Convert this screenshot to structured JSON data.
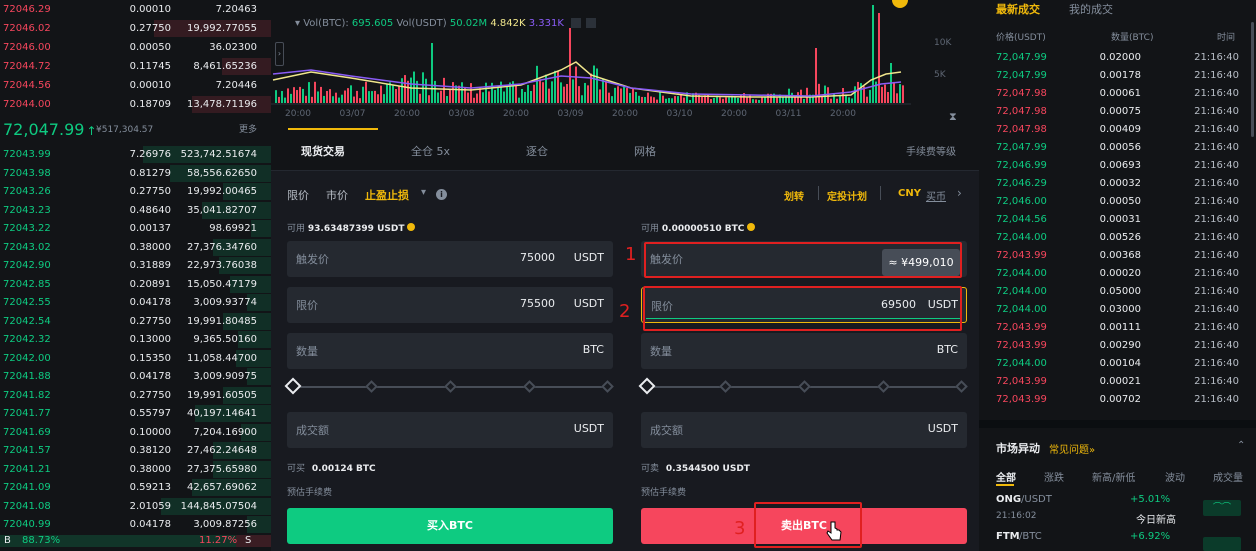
{
  "orderbook": {
    "asks": [
      {
        "price": "72046.29",
        "qty": "0.00010",
        "total": "7.20463"
      },
      {
        "price": "72046.02",
        "qty": "0.27750",
        "total": "19,992.77055"
      },
      {
        "price": "72046.00",
        "qty": "0.00050",
        "total": "36.02300"
      },
      {
        "price": "72044.72",
        "qty": "0.11745",
        "total": "8,461.65236"
      },
      {
        "price": "72044.56",
        "qty": "0.00010",
        "total": "7.20446"
      },
      {
        "price": "72044.00",
        "qty": "0.18709",
        "total": "13,478.71196"
      }
    ],
    "mid_price": "72,047.99",
    "mid_arrow": "↑",
    "mid_cny": "¥517,304.57",
    "more_label": "更多",
    "bids": [
      {
        "price": "72043.99",
        "qty": "7.26976",
        "total": "523,742.51674"
      },
      {
        "price": "72043.98",
        "qty": "0.81279",
        "total": "58,556.62650"
      },
      {
        "price": "72043.26",
        "qty": "0.27750",
        "total": "19,992.00465"
      },
      {
        "price": "72043.23",
        "qty": "0.48640",
        "total": "35,041.82707"
      },
      {
        "price": "72043.22",
        "qty": "0.00137",
        "total": "98.69921"
      },
      {
        "price": "72043.02",
        "qty": "0.38000",
        "total": "27,376.34760"
      },
      {
        "price": "72042.90",
        "qty": "0.31889",
        "total": "22,973.76038"
      },
      {
        "price": "72042.85",
        "qty": "0.20891",
        "total": "15,050.47179"
      },
      {
        "price": "72042.55",
        "qty": "0.04178",
        "total": "3,009.93774"
      },
      {
        "price": "72042.54",
        "qty": "0.27750",
        "total": "19,991.80485"
      },
      {
        "price": "72042.32",
        "qty": "0.13000",
        "total": "9,365.50160"
      },
      {
        "price": "72042.00",
        "qty": "0.15350",
        "total": "11,058.44700"
      },
      {
        "price": "72041.88",
        "qty": "0.04178",
        "total": "3,009.90975"
      },
      {
        "price": "72041.82",
        "qty": "0.27750",
        "total": "19,991.60505"
      },
      {
        "price": "72041.77",
        "qty": "0.55797",
        "total": "40,197.14641"
      },
      {
        "price": "72041.69",
        "qty": "0.10000",
        "total": "7,204.16900"
      },
      {
        "price": "72041.57",
        "qty": "0.38120",
        "total": "27,462.24648"
      },
      {
        "price": "72041.21",
        "qty": "0.38000",
        "total": "27,375.65980"
      },
      {
        "price": "72041.09",
        "qty": "0.59213",
        "total": "42,657.69062"
      },
      {
        "price": "72041.08",
        "qty": "2.01059",
        "total": "144,845.07504"
      },
      {
        "price": "72040.99",
        "qty": "0.04178",
        "total": "3,009.87256"
      }
    ],
    "buy_label": "B",
    "buy_ratio": "88.73%",
    "sell_ratio": "11.27%",
    "sell_label": "S"
  },
  "chart": {
    "legend_vol_btc_label": "Vol(BTC):",
    "legend_vol_btc": "695.605",
    "legend_vol_usdt_label": "Vol(USDT)",
    "legend_vol_usdt": "50.02M",
    "legend_v1": "4.842K",
    "legend_v2": "3.331K",
    "y_ticks": [
      "10K",
      "5K"
    ],
    "x_ticks": [
      "20:00",
      "03/07",
      "20:00",
      "03/08",
      "20:00",
      "03/09",
      "20:00",
      "03/10",
      "20:00",
      "03/11",
      "20:00"
    ]
  },
  "tabs": {
    "items": [
      "现货交易",
      "全仓 5x",
      "逐仓",
      "网格"
    ],
    "fee_label": "手续费等级"
  },
  "form": {
    "order_types": [
      "限价",
      "市价",
      "止盈止损"
    ],
    "transfer": "划转",
    "auto_invest": "定投计划",
    "currency": "CNY",
    "buy_coin": "买币",
    "buy": {
      "available_label": "可用",
      "available_value": "93.63487399 USDT",
      "trigger_label": "触发价",
      "trigger_value": "75000",
      "unit_usdt": "USDT",
      "limit_label": "限价",
      "limit_value": "75500",
      "qty_label": "数量",
      "unit_btc": "BTC",
      "amount_label": "成交额",
      "can_buy_label": "可买",
      "can_buy_value": "0.00124 BTC",
      "fee_label": "预估手续费",
      "button": "买入BTC"
    },
    "sell": {
      "available_label": "可用",
      "available_value": "0.00000510 BTC",
      "trigger_label": "触发价",
      "trigger_tooltip": "≈ ¥499,010",
      "limit_label": "限价",
      "limit_value": "69500",
      "unit_usdt": "USDT",
      "qty_label": "数量",
      "unit_btc": "BTC",
      "amount_label": "成交额",
      "can_sell_label": "可卖",
      "can_sell_value": "0.3544500 USDT",
      "fee_label": "预估手续费",
      "button": "卖出BTC"
    }
  },
  "annotations": [
    "1",
    "2",
    "3"
  ],
  "trades": {
    "tab_latest": "最新成交",
    "tab_mine": "我的成交",
    "headers": [
      "价格(USDT)",
      "数量(BTC)",
      "时间"
    ],
    "rows": [
      {
        "price": "72,047.99",
        "qty": "0.02000",
        "time": "21:16:40",
        "side": "buy"
      },
      {
        "price": "72,047.99",
        "qty": "0.00178",
        "time": "21:16:40",
        "side": "buy"
      },
      {
        "price": "72,047.98",
        "qty": "0.00061",
        "time": "21:16:40",
        "side": "sell"
      },
      {
        "price": "72,047.98",
        "qty": "0.00075",
        "time": "21:16:40",
        "side": "sell"
      },
      {
        "price": "72,047.98",
        "qty": "0.00409",
        "time": "21:16:40",
        "side": "sell"
      },
      {
        "price": "72,047.99",
        "qty": "0.00056",
        "time": "21:16:40",
        "side": "buy"
      },
      {
        "price": "72,046.99",
        "qty": "0.00693",
        "time": "21:16:40",
        "side": "buy"
      },
      {
        "price": "72,046.29",
        "qty": "0.00032",
        "time": "21:16:40",
        "side": "buy"
      },
      {
        "price": "72,046.00",
        "qty": "0.00050",
        "time": "21:16:40",
        "side": "buy"
      },
      {
        "price": "72,044.56",
        "qty": "0.00031",
        "time": "21:16:40",
        "side": "buy"
      },
      {
        "price": "72,044.00",
        "qty": "0.00526",
        "time": "21:16:40",
        "side": "buy"
      },
      {
        "price": "72,043.99",
        "qty": "0.00368",
        "time": "21:16:40",
        "side": "sell"
      },
      {
        "price": "72,044.00",
        "qty": "0.00020",
        "time": "21:16:40",
        "side": "buy"
      },
      {
        "price": "72,044.00",
        "qty": "0.05000",
        "time": "21:16:40",
        "side": "buy"
      },
      {
        "price": "72,044.00",
        "qty": "0.03000",
        "time": "21:16:40",
        "side": "buy"
      },
      {
        "price": "72,043.99",
        "qty": "0.00111",
        "time": "21:16:40",
        "side": "sell"
      },
      {
        "price": "72,043.99",
        "qty": "0.00290",
        "time": "21:16:40",
        "side": "sell"
      },
      {
        "price": "72,044.00",
        "qty": "0.00104",
        "time": "21:16:40",
        "side": "buy"
      },
      {
        "price": "72,043.99",
        "qty": "0.00021",
        "time": "21:16:40",
        "side": "sell"
      },
      {
        "price": "72,043.99",
        "qty": "0.00702",
        "time": "21:16:40",
        "side": "sell"
      }
    ]
  },
  "market": {
    "title": "市场异动",
    "faq": "常见问题",
    "faq_arrow": "»",
    "filters": [
      "全部",
      "涨跌",
      "新高/新低",
      "波动",
      "成交量"
    ],
    "items": [
      {
        "pair": "ONG",
        "quote": "/USDT",
        "time": "21:16:02",
        "change": "+5.01%",
        "desc": "今日新高"
      },
      {
        "pair": "FTM",
        "quote": "/BTC",
        "time": "",
        "change": "+6.92%",
        "desc": ""
      }
    ]
  },
  "colors": {
    "buy": "#0ecb81",
    "sell": "#f6465d",
    "accent": "#f0b90b",
    "annotation": "#e02020"
  }
}
